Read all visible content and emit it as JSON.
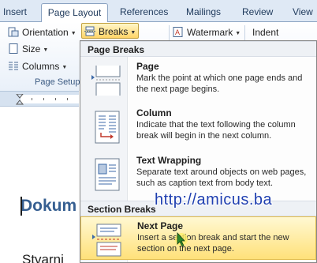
{
  "ribbon": {
    "tabs": [
      {
        "label": "Insert"
      },
      {
        "label": "Page Layout"
      },
      {
        "label": "References"
      },
      {
        "label": "Mailings"
      },
      {
        "label": "Review"
      },
      {
        "label": "View"
      }
    ],
    "buttons": {
      "orientation": "Orientation",
      "breaks": "Breaks",
      "watermark": "Watermark",
      "indent": "Indent",
      "size": "Size",
      "columns": "Columns"
    },
    "group_label": "Page Setup"
  },
  "document": {
    "heading": "Dokum",
    "body_text": "Stvarni"
  },
  "breaks_menu": {
    "page_breaks_header": "Page Breaks",
    "section_breaks_header": "Section Breaks",
    "items": [
      {
        "title": "Page",
        "description": "Mark the point at which one page ends and the next page begins.",
        "icon": "page-break-icon"
      },
      {
        "title": "Column",
        "description": "Indicate that the text following the column break will begin in the next column.",
        "icon": "column-break-icon"
      },
      {
        "title": "Text Wrapping",
        "description": "Separate text around objects on web pages, such as caption text from body text.",
        "icon": "text-wrapping-icon"
      },
      {
        "title": "Next Page",
        "description": "Insert a section break and start the new section on the next page.",
        "icon": "next-page-icon",
        "highlighted": true
      }
    ]
  },
  "watermark_text": "http://amicus.ba",
  "colors": {
    "accent": "#ffd467",
    "heading": "#365f91",
    "watermark": "#1f3fb0"
  }
}
